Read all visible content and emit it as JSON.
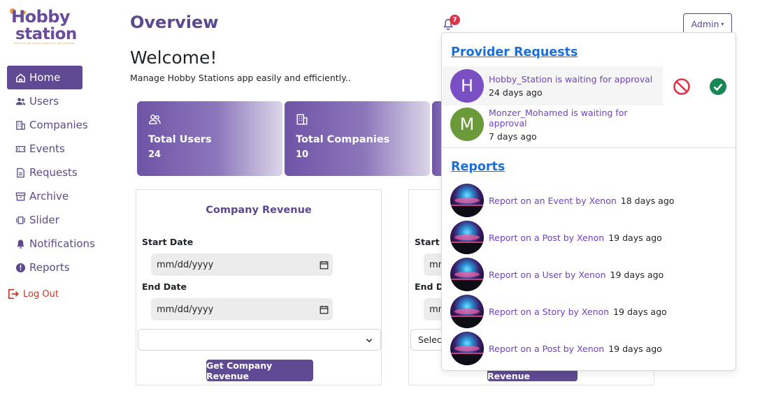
{
  "logo": {
    "line1": "Hobby",
    "line2": "station",
    "tagline": "PRACTICE AND SHARE CAPABILITIES AND PASSIONS"
  },
  "sidebar": {
    "items": [
      {
        "label": "Home",
        "icon": "home-icon"
      },
      {
        "label": "Users",
        "icon": "users-icon"
      },
      {
        "label": "Companies",
        "icon": "building-icon"
      },
      {
        "label": "Events",
        "icon": "ticket-icon"
      },
      {
        "label": "Requests",
        "icon": "document-icon"
      },
      {
        "label": "Archive",
        "icon": "archive-icon"
      },
      {
        "label": "Slider",
        "icon": "slider-icon"
      },
      {
        "label": "Notifications",
        "icon": "bell-icon"
      },
      {
        "label": "Reports",
        "icon": "alert-icon"
      }
    ],
    "logout": "Log Out"
  },
  "header": {
    "title": "Overview",
    "welcome": "Welcome!",
    "subtitle": "Manage Hobby Stations app easily and efficiently..",
    "notification_count": "7",
    "admin_label": "Admin"
  },
  "stats": [
    {
      "label": "Total Users",
      "value": "24"
    },
    {
      "label": "Total Companies",
      "value": "10"
    }
  ],
  "company_card": {
    "title": "Company Revenue",
    "start_label": "Start Date",
    "start_placeholder": "mm/dd/yyyy",
    "end_label": "End Date",
    "end_placeholder": "mm/dd/yyyy",
    "select_value": "",
    "button": "Get Company Revenue"
  },
  "event_card": {
    "start_label": "Start D",
    "start_placeholder": "mm/",
    "end_label": "End Da",
    "end_placeholder": "mm/",
    "select_value": "Select",
    "button": "Get Event Revenue"
  },
  "dropdown": {
    "provider_heading": "Provider Requests",
    "requests": [
      {
        "initial": "H",
        "text": "Hobby_Station is waiting for approval",
        "time": "24 days ago",
        "color": "#7b4fc4"
      },
      {
        "initial": "M",
        "text": "Monzer_Mohamed is waiting for approval",
        "time": "7 days ago",
        "color": "#6a9a3a"
      }
    ],
    "reports_heading": "Reports",
    "reports": [
      {
        "text": "Report on an Event by Xenon",
        "time": "18 days ago"
      },
      {
        "text": "Report on a Post by Xenon",
        "time": "19 days ago"
      },
      {
        "text": "Report on a User by Xenon",
        "time": "19 days ago"
      },
      {
        "text": "Report on a Story by Xenon",
        "time": "19 days ago"
      },
      {
        "text": "Report on a Post by Xenon",
        "time": "19 days ago"
      }
    ]
  },
  "colors": {
    "brand": "#5f4a93",
    "link": "#6f42c1",
    "reject": "#dc3545",
    "approve": "#198754"
  }
}
